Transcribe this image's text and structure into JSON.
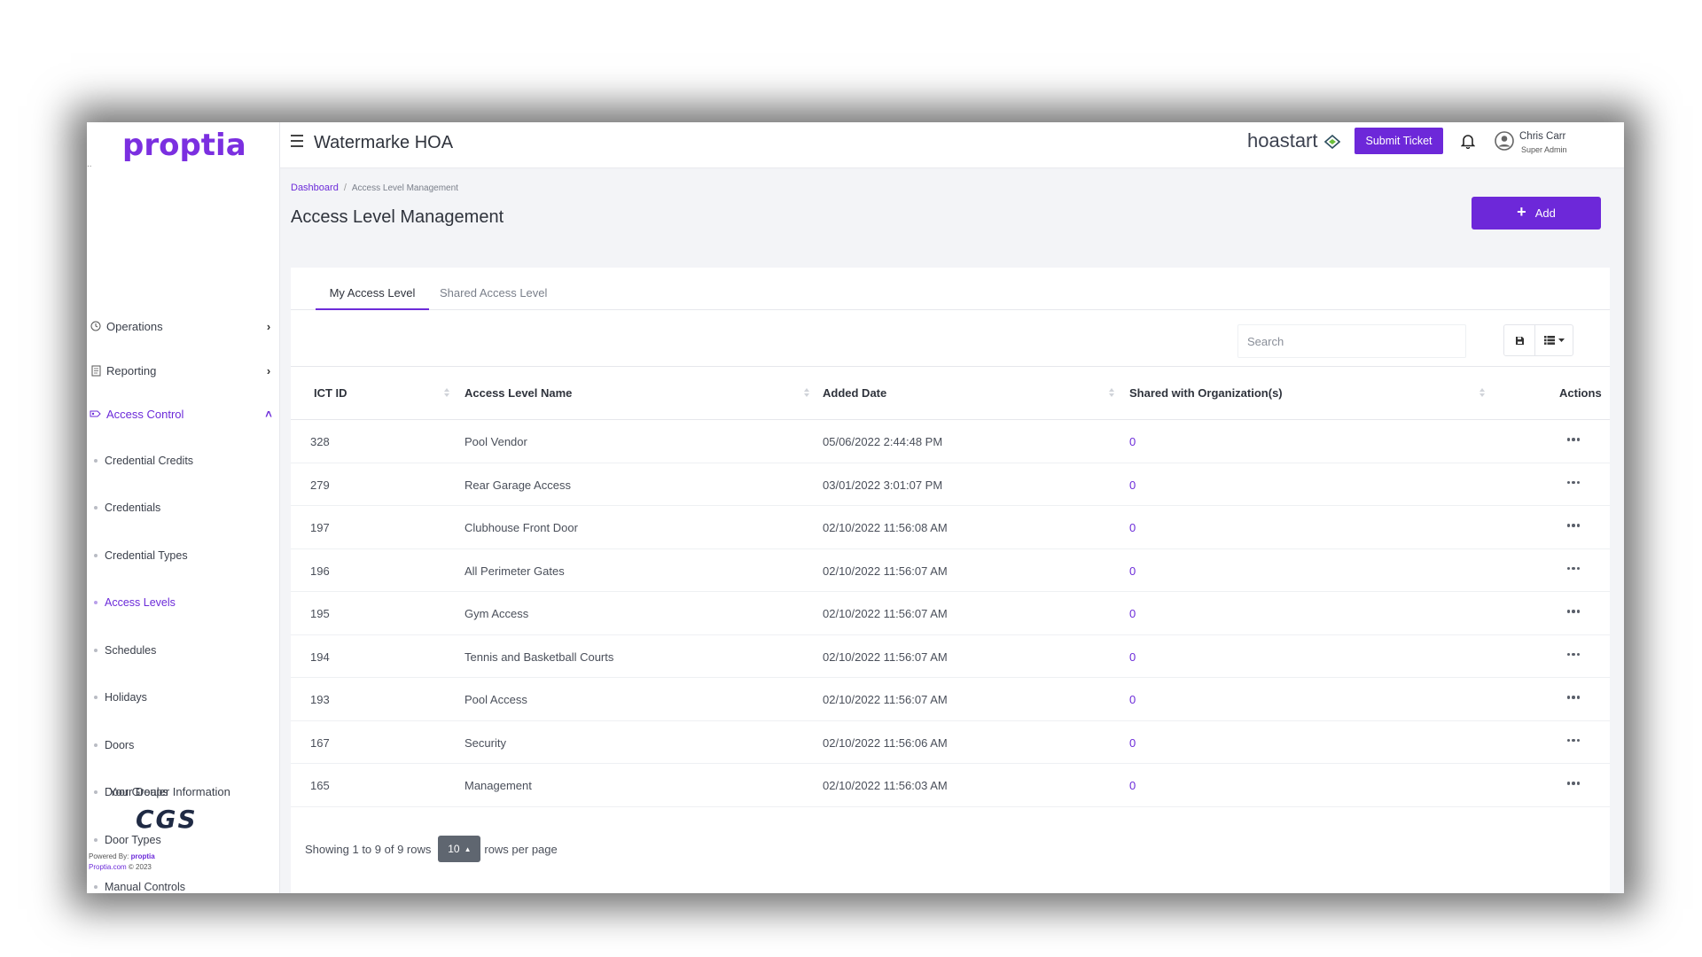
{
  "brand_logo": "proptia",
  "header": {
    "org_title": "Watermarke HOA",
    "partner_brand": "hoastart",
    "submit_ticket_label": "Submit Ticket",
    "user_name": "Chris Carr",
    "user_role": "Super Admin"
  },
  "sidebar": {
    "items": [
      {
        "label": "Operations",
        "icon": "clock-icon"
      },
      {
        "label": "Reporting",
        "icon": "document-icon"
      },
      {
        "label": "Access Control",
        "icon": "access-icon"
      }
    ],
    "sub_items": [
      "Credential Credits",
      "Credentials",
      "Credential Types",
      "Access Levels",
      "Schedules",
      "Holidays",
      "Doors",
      "Door Groups",
      "Door Types",
      "Manual Controls"
    ],
    "dealer_label": "Your Dealer Information",
    "dealer_logo": "CGS",
    "powered_by_label": "Powered By:",
    "powered_by_brand": "proptia",
    "copyright_link": "Proptia.com",
    "copyright_year": "© 2023"
  },
  "breadcrumb": {
    "home": "Dashboard",
    "separator": "/",
    "current": "Access Level Management"
  },
  "page": {
    "title": "Access Level Management",
    "add_label": "Add"
  },
  "tabs": [
    "My Access Level",
    "Shared Access Level"
  ],
  "search": {
    "placeholder": "Search"
  },
  "table": {
    "columns": [
      "ICT ID",
      "Access Level Name",
      "Added Date",
      "Shared with Organization(s)",
      "Actions"
    ],
    "rows": [
      {
        "id": "328",
        "name": "Pool Vendor",
        "date": "05/06/2022 2:44:48 PM",
        "shared": "0"
      },
      {
        "id": "279",
        "name": "Rear Garage Access",
        "date": "03/01/2022 3:01:07 PM",
        "shared": "0"
      },
      {
        "id": "197",
        "name": "Clubhouse Front Door",
        "date": "02/10/2022 11:56:08 AM",
        "shared": "0"
      },
      {
        "id": "196",
        "name": "All Perimeter Gates",
        "date": "02/10/2022 11:56:07 AM",
        "shared": "0"
      },
      {
        "id": "195",
        "name": "Gym Access",
        "date": "02/10/2022 11:56:07 AM",
        "shared": "0"
      },
      {
        "id": "194",
        "name": "Tennis and Basketball Courts",
        "date": "02/10/2022 11:56:07 AM",
        "shared": "0"
      },
      {
        "id": "193",
        "name": "Pool Access",
        "date": "02/10/2022 11:56:07 AM",
        "shared": "0"
      },
      {
        "id": "167",
        "name": "Security",
        "date": "02/10/2022 11:56:06 AM",
        "shared": "0"
      },
      {
        "id": "165",
        "name": "Management",
        "date": "02/10/2022 11:56:03 AM",
        "shared": "0"
      }
    ]
  },
  "pagination": {
    "showing_text": "Showing 1 to 9 of 9 rows",
    "page_size": "10",
    "rows_per_page_label": "rows per page"
  },
  "colors": {
    "accent": "#6d28d9",
    "link": "#6c2bd9",
    "page_size_bg": "#5f6670"
  }
}
